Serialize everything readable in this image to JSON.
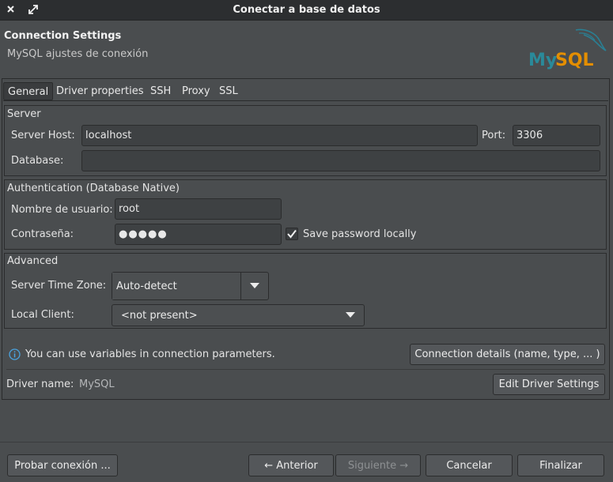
{
  "window": {
    "title": "Conectar a base de datos",
    "close_icon": "close-icon",
    "maximize_icon": "maximize-icon"
  },
  "header": {
    "title": "Connection Settings",
    "subtitle": "MySQL ajustes de conexión",
    "logo_text": "MySQL"
  },
  "tabs": [
    {
      "label": "General",
      "active": true
    },
    {
      "label": "Driver properties"
    },
    {
      "label": "SSH"
    },
    {
      "label": "Proxy"
    },
    {
      "label": "SSL"
    }
  ],
  "server": {
    "group_label": "Server",
    "host_label": "Server Host:",
    "host_value": "localhost",
    "port_label": "Port:",
    "port_value": "3306",
    "database_label": "Database:",
    "database_value": ""
  },
  "auth": {
    "group_label": "Authentication (Database Native)",
    "user_label": "Nombre de usuario:",
    "user_value": "root",
    "password_label": "Contraseña:",
    "password_mask": "●●●●●",
    "save_password_label": "Save password locally",
    "save_password_checked": true
  },
  "advanced": {
    "group_label": "Advanced",
    "timezone_label": "Server Time Zone:",
    "timezone_value": "Auto-detect",
    "client_label": "Local Client:",
    "client_value": "<not present>"
  },
  "info": {
    "text": "You can use variables in connection parameters.",
    "details_button": "Connection details (name, type, ... )"
  },
  "driver": {
    "label": "Driver name:",
    "value": "MySQL",
    "edit_button": "Edit Driver Settings"
  },
  "footer": {
    "test_button": "Probar conexión ...",
    "back_button": "← Anterior",
    "next_button": "Siguiente →",
    "cancel_button": "Cancelar",
    "finish_button": "Finalizar"
  },
  "colors": {
    "background": "#4a4d4f",
    "titlebar": "#2c2e30",
    "input_bg": "#3e4143",
    "logo_blue": "#5d87a1",
    "logo_teal": "#2a8a9a",
    "info_blue": "#4aa3df"
  }
}
